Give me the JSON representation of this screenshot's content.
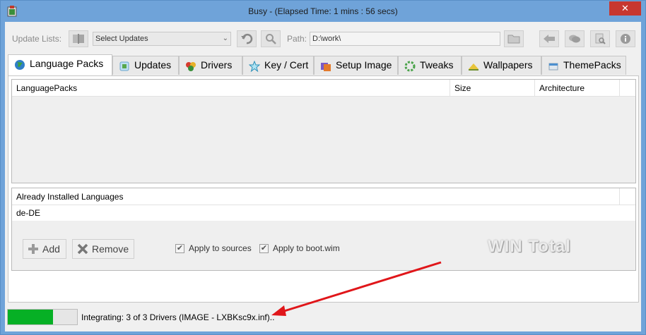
{
  "window": {
    "title": "Busy - (Elapsed Time: 1 mins : 56 secs)",
    "close_label": "✕"
  },
  "toolbar": {
    "update_lists_label": "Update Lists:",
    "select_updates_value": "Select Updates",
    "path_label": "Path:",
    "path_value": "D:\\work\\"
  },
  "tabs": [
    {
      "label": "Language Packs",
      "active": true
    },
    {
      "label": "Updates"
    },
    {
      "label": "Drivers"
    },
    {
      "label": "Key / Cert"
    },
    {
      "label": "Setup Image"
    },
    {
      "label": "Tweaks"
    },
    {
      "label": "Wallpapers"
    },
    {
      "label": "ThemePacks"
    }
  ],
  "language_packs_grid": {
    "columns": [
      "LanguagePacks",
      "Size",
      "Architecture"
    ],
    "rows": []
  },
  "installed_grid": {
    "columns": [
      "Already Installed Languages"
    ],
    "rows": [
      "de-DE"
    ]
  },
  "buttons": {
    "add_label": "Add",
    "remove_label": "Remove"
  },
  "checkboxes": {
    "apply_sources_label": "Apply to sources",
    "apply_sources_checked": true,
    "apply_boot_label": "Apply to boot.wim",
    "apply_boot_checked": true
  },
  "watermark": "WIN Total",
  "status": {
    "progress_fraction": 0.65,
    "text": "Integrating: 3 of 3 Drivers (IMAGE - LXBKsc9x.inf).."
  },
  "colors": {
    "titlebar": "#6fa3d9",
    "close": "#c7372f",
    "progress": "#06b025",
    "arrow": "#e0161a"
  }
}
